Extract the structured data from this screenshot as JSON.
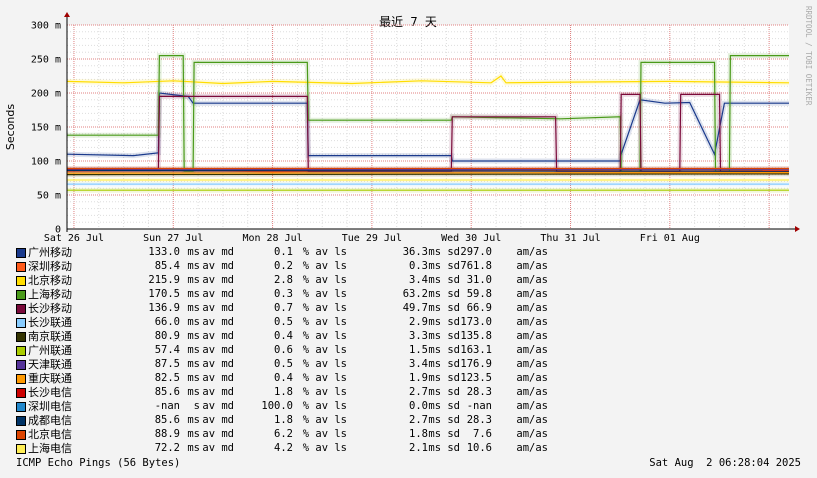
{
  "chart_data": {
    "type": "line",
    "title": "最近 7 天",
    "ylabel": "Seconds",
    "watermark": "RRDTOOL / TOBI OETIKER",
    "y_ticks": [
      {
        "v": 0,
        "label": "0"
      },
      {
        "v": 50,
        "label": "50 m"
      },
      {
        "v": 100,
        "label": "100 m"
      },
      {
        "v": 150,
        "label": "150 m"
      },
      {
        "v": 200,
        "label": "200 m"
      },
      {
        "v": 250,
        "label": "250 m"
      },
      {
        "v": 300,
        "label": "300 m"
      }
    ],
    "ylim": [
      0,
      300
    ],
    "x_ticks": [
      {
        "t": 0,
        "label": "Sat 26 Jul"
      },
      {
        "t": 1,
        "label": "Sun 27 Jul"
      },
      {
        "t": 2,
        "label": "Mon 28 Jul"
      },
      {
        "t": 3,
        "label": "Tue 29 Jul"
      },
      {
        "t": 4,
        "label": "Wed 30 Jul"
      },
      {
        "t": 5,
        "label": "Thu 31 Jul"
      },
      {
        "t": 6,
        "label": "Fri 01 Aug"
      }
    ],
    "xlim": [
      -0.07,
      7.2
    ],
    "grid": true,
    "series": [
      {
        "name": "广州移动",
        "color": "#1a3a8c",
        "points": [
          [
            -0.07,
            110
          ],
          [
            0.6,
            108
          ],
          [
            0.85,
            112
          ],
          [
            0.86,
            200
          ],
          [
            1.15,
            195
          ],
          [
            1.2,
            185
          ],
          [
            2.35,
            185
          ],
          [
            2.36,
            108
          ],
          [
            3.8,
            108
          ],
          [
            3.81,
            100
          ],
          [
            5.5,
            100
          ],
          [
            5.51,
            110
          ],
          [
            5.7,
            190
          ],
          [
            5.95,
            185
          ],
          [
            6.2,
            186
          ],
          [
            6.45,
            110
          ],
          [
            6.55,
            185
          ],
          [
            7.2,
            185
          ]
        ]
      },
      {
        "name": "深圳移动",
        "color": "#ff5a1a",
        "points": [
          [
            -0.07,
            85
          ],
          [
            1.0,
            87
          ],
          [
            2.0,
            84
          ],
          [
            3.0,
            86
          ],
          [
            4.0,
            85
          ],
          [
            5.0,
            86
          ],
          [
            6.0,
            85
          ],
          [
            7.2,
            86
          ]
        ]
      },
      {
        "name": "北京移动",
        "color": "#ffdd00",
        "points": [
          [
            -0.07,
            217
          ],
          [
            0.5,
            215
          ],
          [
            1.0,
            218
          ],
          [
            1.5,
            214
          ],
          [
            2.0,
            217
          ],
          [
            2.8,
            214
          ],
          [
            3.5,
            218
          ],
          [
            4.2,
            215
          ],
          [
            4.3,
            225
          ],
          [
            4.35,
            215
          ],
          [
            5.0,
            216
          ],
          [
            6.0,
            217
          ],
          [
            7.2,
            215
          ]
        ]
      },
      {
        "name": "上海移动",
        "color": "#4a9a1a",
        "points": [
          [
            -0.07,
            138
          ],
          [
            0.85,
            138
          ],
          [
            0.86,
            255
          ],
          [
            1.1,
            255
          ],
          [
            1.11,
            85
          ],
          [
            1.2,
            85
          ],
          [
            1.21,
            245
          ],
          [
            2.35,
            245
          ],
          [
            2.36,
            160
          ],
          [
            3.8,
            160
          ],
          [
            3.81,
            165
          ],
          [
            4.9,
            162
          ],
          [
            5.5,
            165
          ],
          [
            5.51,
            85
          ],
          [
            5.7,
            85
          ],
          [
            5.71,
            245
          ],
          [
            6.45,
            245
          ],
          [
            6.46,
            85
          ],
          [
            6.6,
            85
          ],
          [
            6.61,
            255
          ],
          [
            7.2,
            255
          ]
        ]
      },
      {
        "name": "长沙移动",
        "color": "#7a0a3a",
        "points": [
          [
            -0.07,
            88
          ],
          [
            0.85,
            88
          ],
          [
            0.86,
            195
          ],
          [
            2.35,
            195
          ],
          [
            2.36,
            85
          ],
          [
            3.8,
            85
          ],
          [
            3.81,
            165
          ],
          [
            4.85,
            165
          ],
          [
            4.86,
            85
          ],
          [
            5.5,
            85
          ],
          [
            5.51,
            198
          ],
          [
            5.7,
            198
          ],
          [
            5.71,
            85
          ],
          [
            6.1,
            85
          ],
          [
            6.11,
            198
          ],
          [
            6.5,
            198
          ],
          [
            6.51,
            85
          ],
          [
            7.2,
            85
          ]
        ]
      },
      {
        "name": "长沙联通",
        "color": "#88ccff",
        "points": [
          [
            -0.07,
            66
          ],
          [
            7.2,
            66
          ]
        ]
      },
      {
        "name": "南京联通",
        "color": "#333300",
        "points": [
          [
            -0.07,
            80
          ],
          [
            7.2,
            81
          ]
        ]
      },
      {
        "name": "广州联通",
        "color": "#aacc00",
        "points": [
          [
            -0.07,
            57
          ],
          [
            7.2,
            57
          ]
        ]
      },
      {
        "name": "天津联通",
        "color": "#553399",
        "points": [
          [
            -0.07,
            87
          ],
          [
            7.2,
            88
          ]
        ]
      },
      {
        "name": "重庆联通",
        "color": "#ff9900",
        "points": [
          [
            -0.07,
            82
          ],
          [
            7.2,
            83
          ]
        ]
      },
      {
        "name": "长沙电信",
        "color": "#cc0000",
        "points": [
          [
            -0.07,
            86
          ],
          [
            7.2,
            85
          ]
        ]
      },
      {
        "name": "深圳电信",
        "color": "#2288cc",
        "points": []
      },
      {
        "name": "成都电信",
        "color": "#003366",
        "points": [
          [
            -0.07,
            86
          ],
          [
            7.2,
            85
          ]
        ]
      },
      {
        "name": "北京电信",
        "color": "#dd4400",
        "points": [
          [
            -0.07,
            89
          ],
          [
            7.2,
            89
          ]
        ]
      },
      {
        "name": "上海电信",
        "color": "#ffee55",
        "points": [
          [
            -0.07,
            72
          ],
          [
            7.2,
            72
          ]
        ]
      }
    ]
  },
  "legend": {
    "rows": [
      {
        "name": "广州移动",
        "color": "#1a3a8c",
        "avg": "133.0",
        "avg_unit": "ms",
        "avg_tag": "av md",
        "loss": "0.1",
        "loss_tag": "% av ls",
        "sd": "36.3",
        "sd_tag": "ms sd",
        "amas": "297.0",
        "amas_tag": "am/as"
      },
      {
        "name": "深圳移动",
        "color": "#ff5a1a",
        "avg": "85.4",
        "avg_unit": "ms",
        "avg_tag": "av md",
        "loss": "0.2",
        "loss_tag": "% av ls",
        "sd": "0.3",
        "sd_tag": "ms sd",
        "amas": "761.8",
        "amas_tag": "am/as"
      },
      {
        "name": "北京移动",
        "color": "#ffdd00",
        "avg": "215.9",
        "avg_unit": "ms",
        "avg_tag": "av md",
        "loss": "2.8",
        "loss_tag": "% av ls",
        "sd": "3.4",
        "sd_tag": "ms sd",
        "amas": "31.0",
        "amas_tag": "am/as"
      },
      {
        "name": "上海移动",
        "color": "#4a9a1a",
        "avg": "170.5",
        "avg_unit": "ms",
        "avg_tag": "av md",
        "loss": "0.3",
        "loss_tag": "% av ls",
        "sd": "63.2",
        "sd_tag": "ms sd",
        "amas": "59.8",
        "amas_tag": "am/as"
      },
      {
        "name": "长沙移动",
        "color": "#7a0a3a",
        "avg": "136.9",
        "avg_unit": "ms",
        "avg_tag": "av md",
        "loss": "0.7",
        "loss_tag": "% av ls",
        "sd": "49.7",
        "sd_tag": "ms sd",
        "amas": "66.9",
        "amas_tag": "am/as"
      },
      {
        "name": "长沙联通",
        "color": "#88ccff",
        "avg": "66.0",
        "avg_unit": "ms",
        "avg_tag": "av md",
        "loss": "0.5",
        "loss_tag": "% av ls",
        "sd": "2.9",
        "sd_tag": "ms sd",
        "amas": "173.0",
        "amas_tag": "am/as"
      },
      {
        "name": "南京联通",
        "color": "#333300",
        "avg": "80.9",
        "avg_unit": "ms",
        "avg_tag": "av md",
        "loss": "0.4",
        "loss_tag": "% av ls",
        "sd": "3.3",
        "sd_tag": "ms sd",
        "amas": "135.8",
        "amas_tag": "am/as"
      },
      {
        "name": "广州联通",
        "color": "#aacc00",
        "avg": "57.4",
        "avg_unit": "ms",
        "avg_tag": "av md",
        "loss": "0.6",
        "loss_tag": "% av ls",
        "sd": "1.5",
        "sd_tag": "ms sd",
        "amas": "163.1",
        "amas_tag": "am/as"
      },
      {
        "name": "天津联通",
        "color": "#553399",
        "avg": "87.5",
        "avg_unit": "ms",
        "avg_tag": "av md",
        "loss": "0.5",
        "loss_tag": "% av ls",
        "sd": "3.4",
        "sd_tag": "ms sd",
        "amas": "176.9",
        "amas_tag": "am/as"
      },
      {
        "name": "重庆联通",
        "color": "#ff9900",
        "avg": "82.5",
        "avg_unit": "ms",
        "avg_tag": "av md",
        "loss": "0.4",
        "loss_tag": "% av ls",
        "sd": "1.9",
        "sd_tag": "ms sd",
        "amas": "123.5",
        "amas_tag": "am/as"
      },
      {
        "name": "长沙电信",
        "color": "#cc0000",
        "avg": "85.6",
        "avg_unit": "ms",
        "avg_tag": "av md",
        "loss": "1.8",
        "loss_tag": "% av ls",
        "sd": "2.7",
        "sd_tag": "ms sd",
        "amas": "28.3",
        "amas_tag": "am/as"
      },
      {
        "name": "深圳电信",
        "color": "#2288cc",
        "avg": "-nan",
        "avg_unit": "s",
        "avg_tag": "av md",
        "loss": "100.0",
        "loss_tag": "% av ls",
        "sd": "0.0",
        "sd_tag": "ms sd",
        "amas": "-nan",
        "amas_tag": "am/as"
      },
      {
        "name": "成都电信",
        "color": "#003366",
        "avg": "85.6",
        "avg_unit": "ms",
        "avg_tag": "av md",
        "loss": "1.8",
        "loss_tag": "% av ls",
        "sd": "2.7",
        "sd_tag": "ms sd",
        "amas": "28.3",
        "amas_tag": "am/as"
      },
      {
        "name": "北京电信",
        "color": "#dd4400",
        "avg": "88.9",
        "avg_unit": "ms",
        "avg_tag": "av md",
        "loss": "6.2",
        "loss_tag": "% av ls",
        "sd": "1.8",
        "sd_tag": "ms sd",
        "amas": "7.6",
        "amas_tag": "am/as"
      },
      {
        "name": "上海电信",
        "color": "#ffee55",
        "avg": "72.2",
        "avg_unit": "ms",
        "avg_tag": "av md",
        "loss": "4.2",
        "loss_tag": "% av ls",
        "sd": "2.1",
        "sd_tag": "ms sd",
        "amas": "10.6",
        "amas_tag": "am/as"
      }
    ]
  },
  "footer": {
    "left": "ICMP Echo Pings (56 Bytes)",
    "right": "Sat Aug  2 06:28:04 2025"
  }
}
